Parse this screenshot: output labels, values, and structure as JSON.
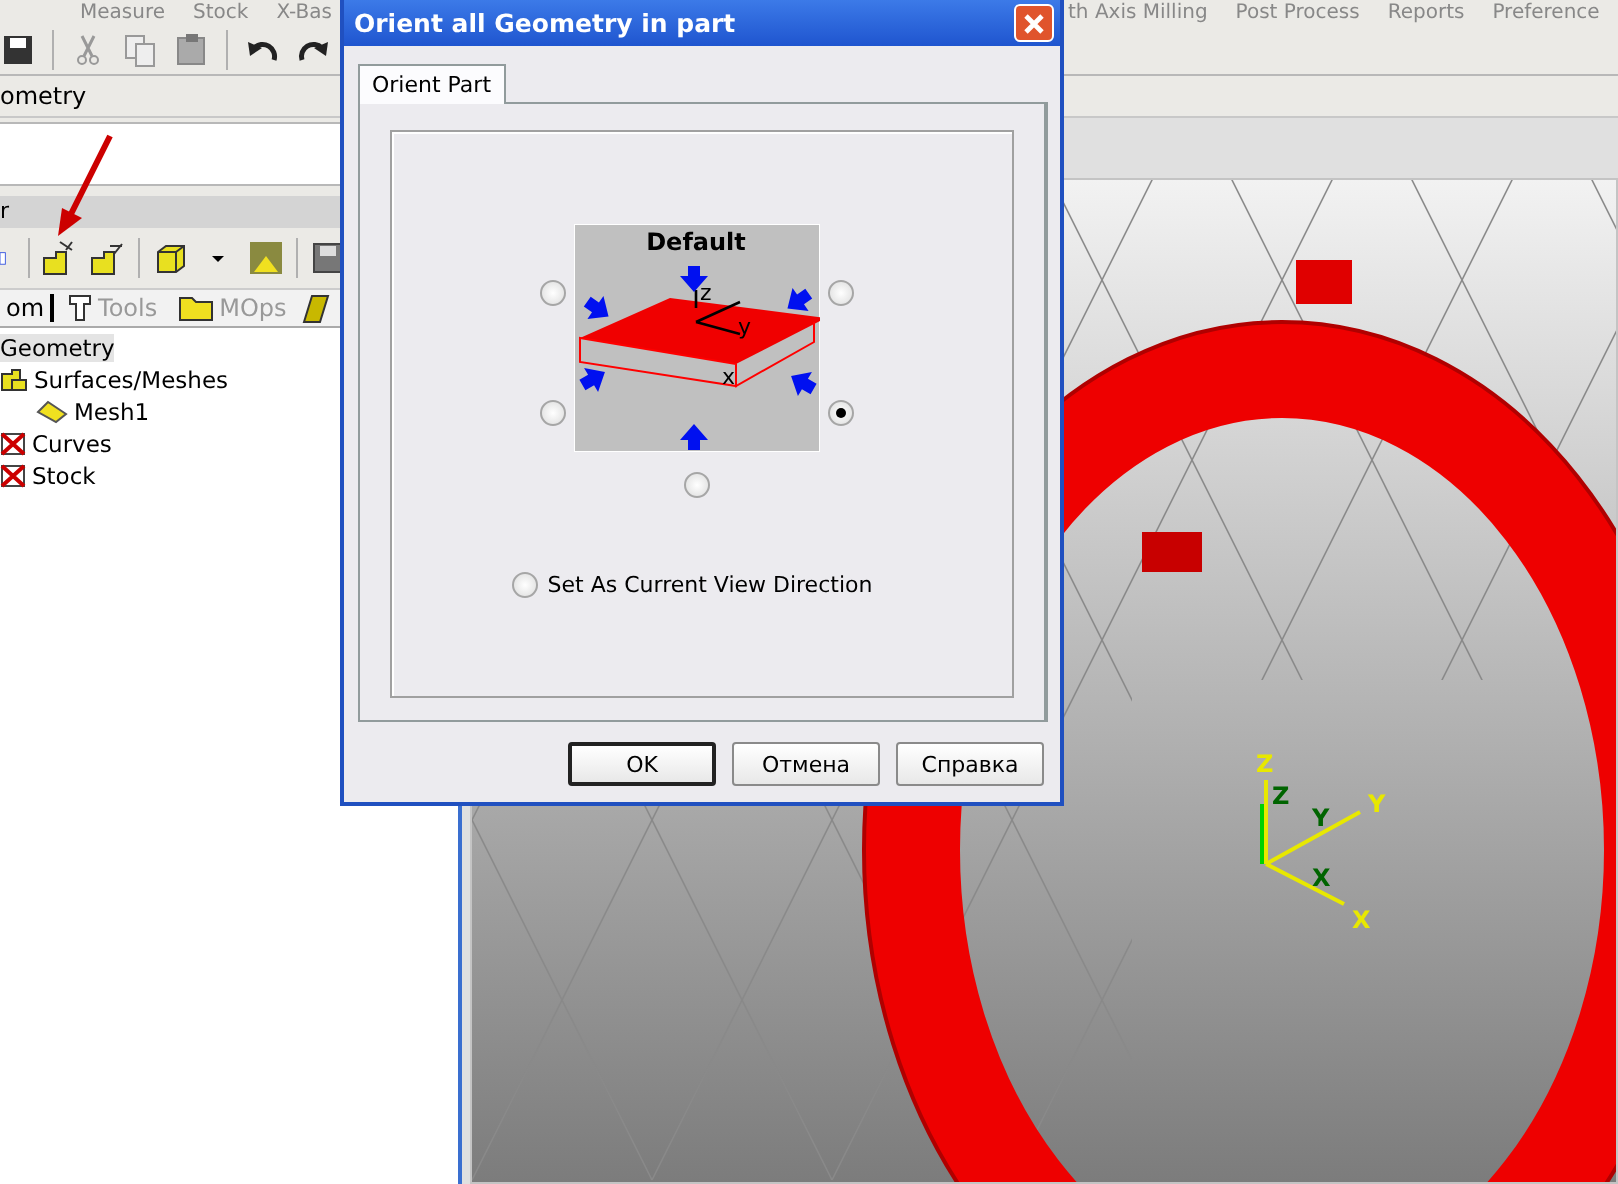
{
  "menu": [
    {
      "label": "Measure"
    },
    {
      "label": "Stock"
    },
    {
      "label": "X-Bas"
    },
    {
      "label": "th Axis Milling"
    },
    {
      "label": "Post Process"
    },
    {
      "label": "Reports"
    },
    {
      "label": "Preference"
    }
  ],
  "breadcrumb": "ometry",
  "panel": {
    "title": "r",
    "tabs": [
      {
        "label": "om",
        "selected": true
      },
      {
        "label": "Tools",
        "selected": false
      },
      {
        "label": "MOps",
        "selected": false
      }
    ],
    "tree": [
      {
        "label": "Geometry",
        "selected": true,
        "children": [
          {
            "label": "Surfaces/Meshes",
            "kind": "surfaces",
            "selected": false,
            "children": [
              {
                "label": "Mesh1",
                "kind": "mesh",
                "selected": false
              }
            ]
          },
          {
            "label": "Curves",
            "kind": "empty",
            "selected": false
          },
          {
            "label": "Stock",
            "kind": "empty",
            "selected": false
          }
        ]
      }
    ]
  },
  "viewport": {
    "axis_labels": [
      "Z",
      "Y",
      "X"
    ],
    "inner_axis_labels": [
      "Z",
      "Y",
      "X"
    ]
  },
  "dialog": {
    "title": "Orient all Geometry in part",
    "tabs": [
      {
        "label": "Orient Part",
        "selected": true
      }
    ],
    "preview": {
      "title": "Default",
      "axes": [
        "z",
        "y",
        "x"
      ]
    },
    "directions": [
      {
        "selected": false
      },
      {
        "selected": false
      },
      {
        "selected": false
      },
      {
        "selected": true
      },
      {
        "selected": false
      }
    ],
    "view_direction": {
      "label": "Set As Current View Direction",
      "selected": false
    },
    "buttons": [
      {
        "label": "OK",
        "default": true
      },
      {
        "label": "Отмена",
        "default": false
      },
      {
        "label": "Справка",
        "default": false
      }
    ]
  }
}
